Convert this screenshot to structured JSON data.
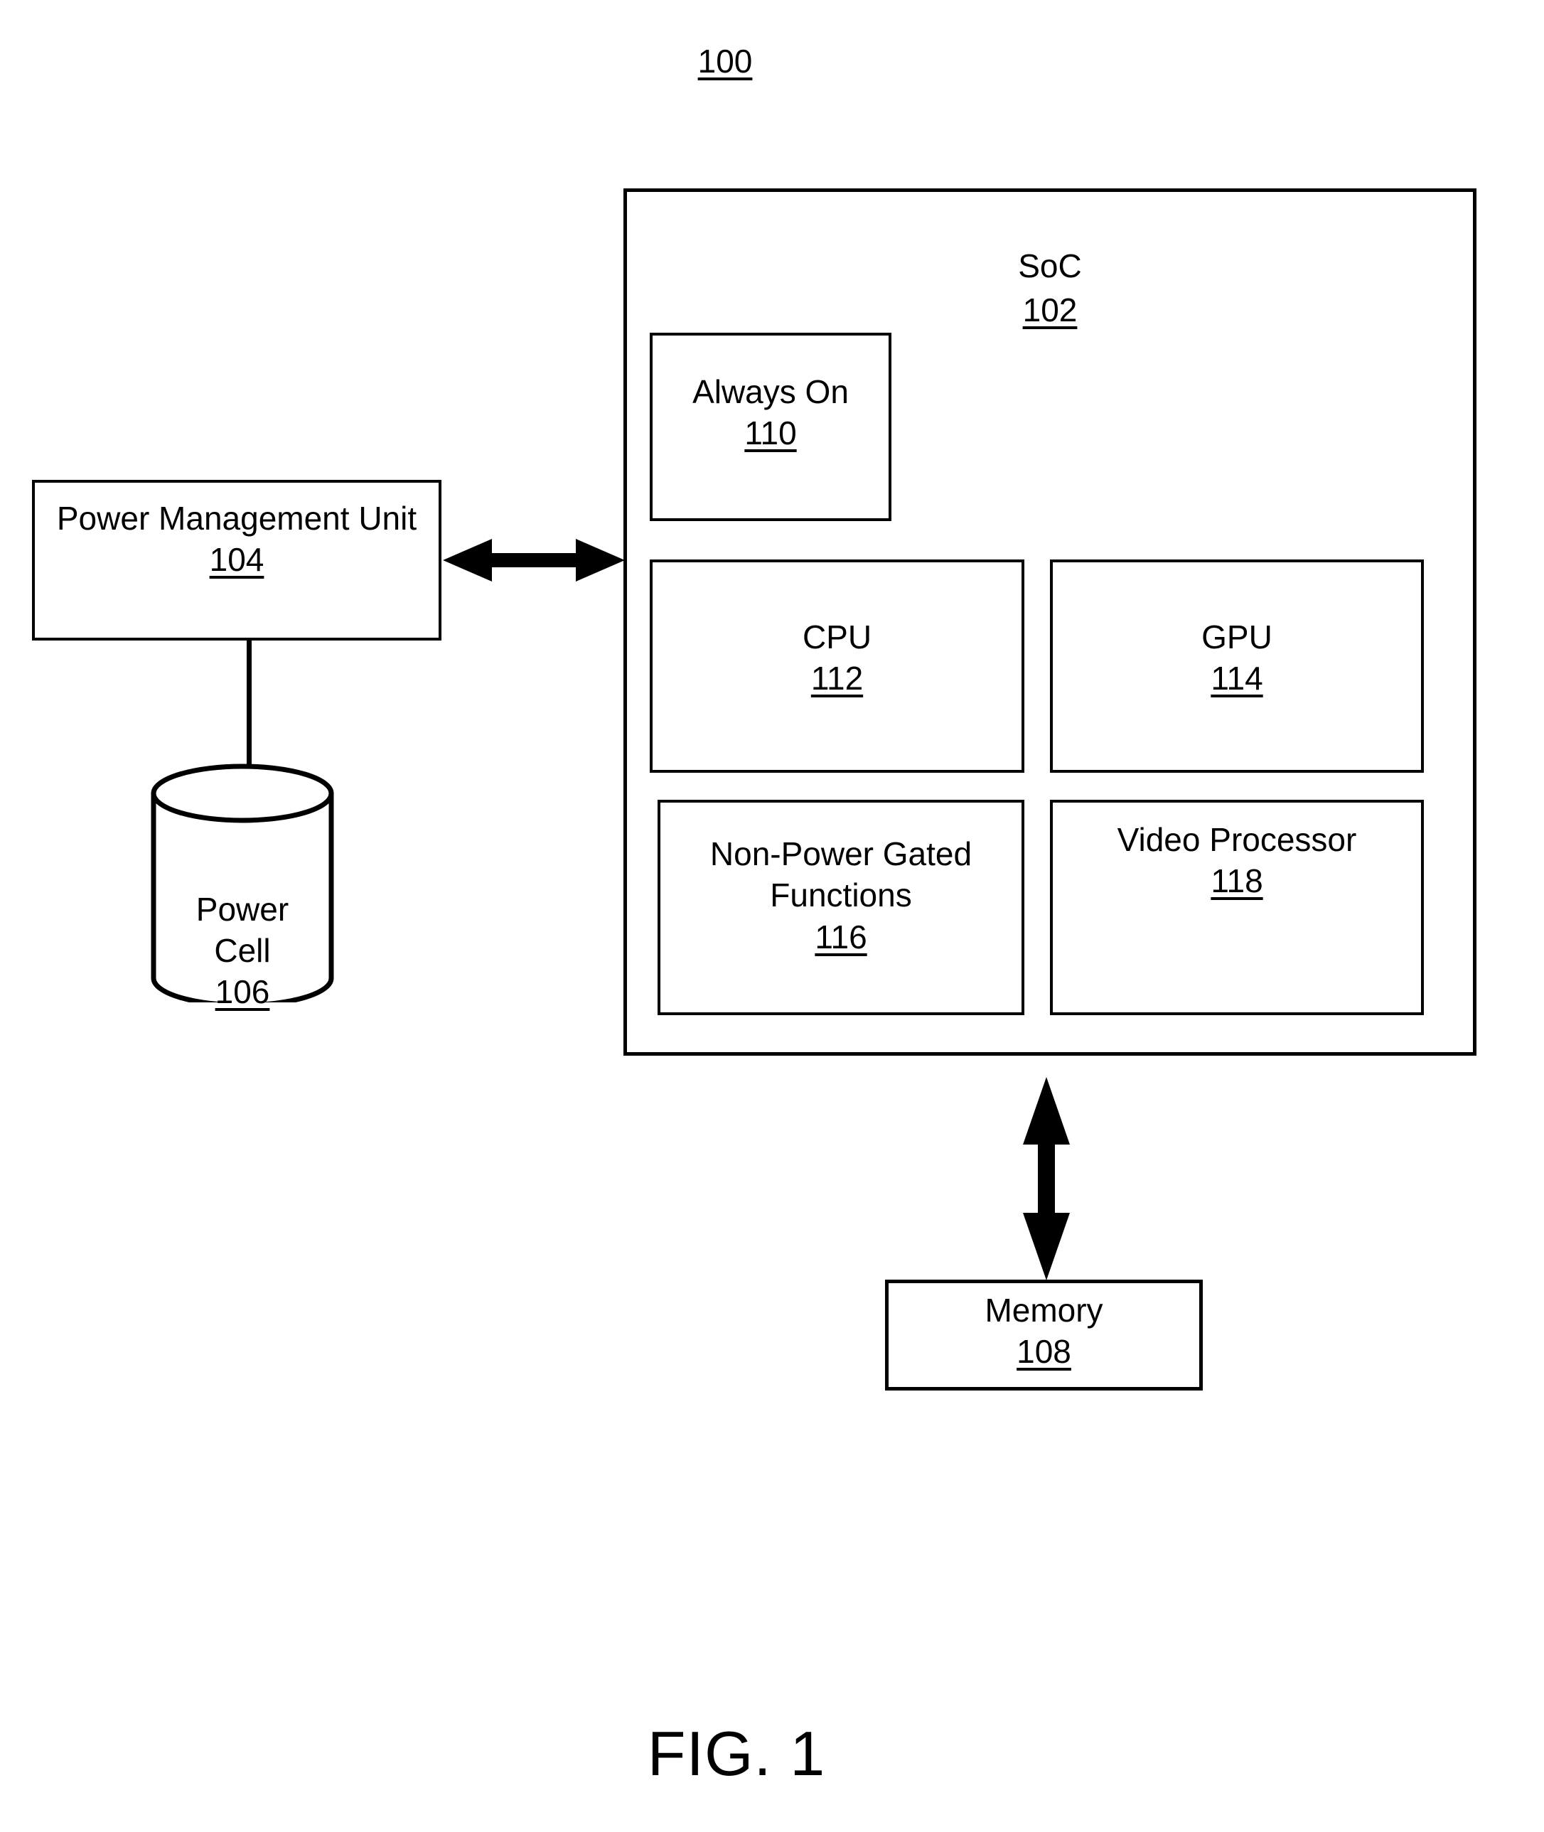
{
  "figure": {
    "system_ref": "100",
    "caption": "FIG. 1"
  },
  "soc": {
    "label": "SoC",
    "ref": "102",
    "blocks": [
      {
        "name": "always-on",
        "label": "Always On",
        "ref": "110"
      },
      {
        "name": "cpu",
        "label": "CPU",
        "ref": "112"
      },
      {
        "name": "gpu",
        "label": "GPU",
        "ref": "114"
      },
      {
        "name": "non-power-gated",
        "label": "Non-Power Gated\nFunctions",
        "ref": "116"
      },
      {
        "name": "video-processor",
        "label": "Video\nProcessor",
        "ref": "118"
      }
    ]
  },
  "power_management_unit": {
    "label": "Power Management\nUnit",
    "ref": "104"
  },
  "power_cell": {
    "label": "Power\nCell",
    "ref": "106"
  },
  "memory": {
    "label": "Memory",
    "ref": "108"
  },
  "connectors": [
    {
      "name": "pmu-soc-bus",
      "kind": "double-arrow",
      "orientation": "horizontal"
    },
    {
      "name": "pmu-power-cell",
      "kind": "line",
      "orientation": "vertical"
    },
    {
      "name": "soc-memory-bus",
      "kind": "double-arrow",
      "orientation": "vertical"
    }
  ],
  "colors": {
    "stroke": "#000000",
    "background": "#ffffff"
  }
}
